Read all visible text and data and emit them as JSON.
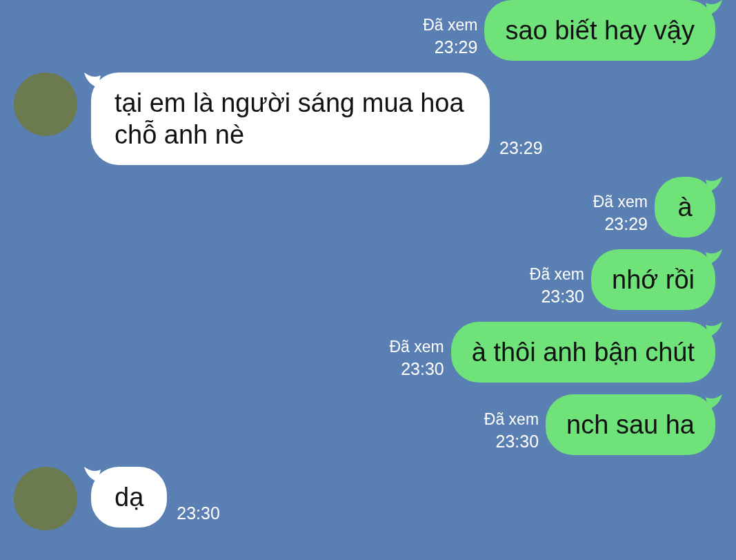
{
  "messages": [
    {
      "kind": "outgoing",
      "text": "sao biết hay vậy",
      "read_label": "Đã xem",
      "time": "23:29"
    },
    {
      "kind": "incoming",
      "text": "tại em là người sáng mua hoa chỗ anh nè",
      "time": "23:29"
    },
    {
      "kind": "outgoing",
      "text": "à",
      "read_label": "Đã xem",
      "time": "23:29"
    },
    {
      "kind": "outgoing",
      "text": "nhớ rồi",
      "read_label": "Đã xem",
      "time": "23:30"
    },
    {
      "kind": "outgoing",
      "text": "à thôi anh bận chút",
      "read_label": "Đã xem",
      "time": "23:30"
    },
    {
      "kind": "outgoing",
      "text": "nch sau ha",
      "read_label": "Đã xem",
      "time": "23:30"
    },
    {
      "kind": "incoming",
      "text": "dạ",
      "time": "23:30"
    }
  ]
}
